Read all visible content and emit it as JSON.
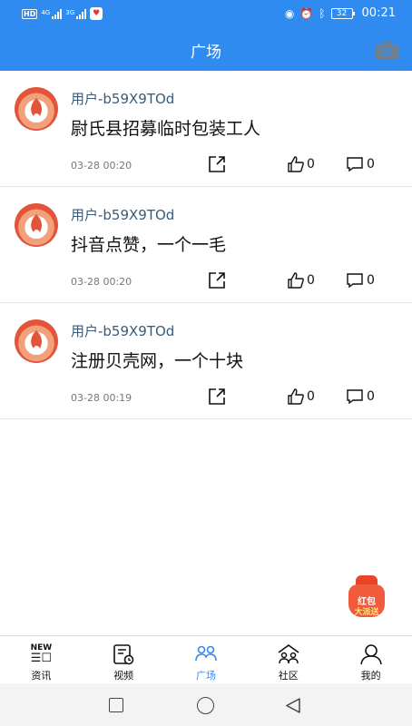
{
  "status_bar": {
    "hd_label": "HD",
    "network_1": "4G",
    "network_2": "3G",
    "battery": "32",
    "time": "00:21"
  },
  "header": {
    "title": "广场",
    "camera_icon": "camera-icon"
  },
  "posts": [
    {
      "username": "用户-b59X9TOd",
      "content": "尉氏县招募临时包装工人",
      "time": "03-28 00:20",
      "likes": "0",
      "comments": "0"
    },
    {
      "username": "用户-b59X9TOd",
      "content": "抖音点赞，一个一毛",
      "time": "03-28 00:20",
      "likes": "0",
      "comments": "0"
    },
    {
      "username": "用户-b59X9TOd",
      "content": "注册贝壳网，一个十块",
      "time": "03-28 00:19",
      "likes": "0",
      "comments": "0"
    }
  ],
  "red_packet": {
    "line1": "红包",
    "line2": "大派送"
  },
  "tabs": [
    {
      "label": "资讯",
      "icon": "news-icon",
      "badge": "NEW"
    },
    {
      "label": "视频",
      "icon": "video-icon"
    },
    {
      "label": "广场",
      "icon": "square-people-icon",
      "active": true
    },
    {
      "label": "社区",
      "icon": "community-icon"
    },
    {
      "label": "我的",
      "icon": "profile-icon"
    }
  ],
  "colors": {
    "primary": "#2f8bf0",
    "username": "#3a5a78",
    "red_packet": "#f15b3b"
  }
}
